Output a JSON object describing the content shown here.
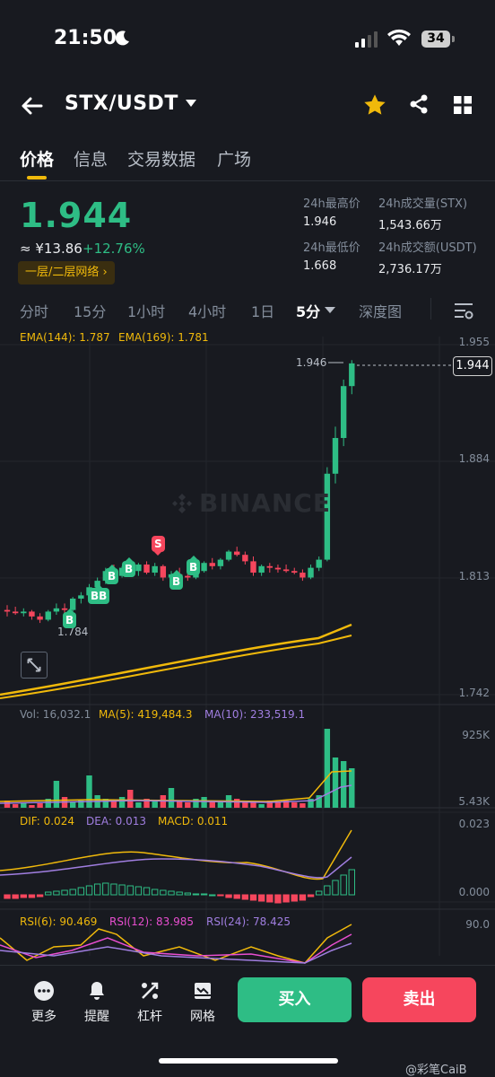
{
  "status": {
    "time": "21:50",
    "battery": "34"
  },
  "header": {
    "pair": "STX/USDT"
  },
  "tabs": [
    "价格",
    "信息",
    "交易数据",
    "广场"
  ],
  "ticker": {
    "price": "1.944",
    "cny": "≈ ¥13.86",
    "change": "+12.76%",
    "badge": "一层/二层网络 ›",
    "high_label": "24h最高价",
    "high": "1.946",
    "low_label": "24h最低价",
    "low": "1.668",
    "vol_label": "24h成交量(STX)",
    "vol": "1,543.66万",
    "amt_label": "24h成交额(USDT)",
    "amt": "2,736.17万"
  },
  "intervals": [
    "分时",
    "15分",
    "1小时",
    "4小时",
    "1日",
    "5分",
    "深度图"
  ],
  "main_chart": {
    "ema144": "EMA(144): 1.787",
    "ema169": "EMA(169): 1.781",
    "axis": [
      "1.955",
      "1.884",
      "1.813",
      "1.742"
    ],
    "high_marker": "1.946",
    "low_marker": "1.784",
    "last_price_tag": "1.944",
    "watermark": "BINANCE"
  },
  "volume_panel": {
    "vol": "Vol: 16,032.1",
    "ma5": "MA(5): 419,484.3",
    "ma10": "MA(10): 233,519.1",
    "axis_top": "925K",
    "axis_bottom": "5.43K"
  },
  "macd_panel": {
    "dif": "DIF: 0.024",
    "dea": "DEA: 0.013",
    "macd": "MACD: 0.011",
    "axis_top": "0.023",
    "axis_bottom": "0.000"
  },
  "rsi_panel": {
    "rsi6": "RSI(6): 90.469",
    "rsi12": "RSI(12): 83.985",
    "rsi24": "RSI(24): 78.425",
    "axis_top": "90.0"
  },
  "trade_marks": [
    "B",
    "BB",
    "B",
    "B",
    "S",
    "B",
    "B"
  ],
  "bottom_bar": {
    "more": "更多",
    "alert": "提醒",
    "leverage": "杠杆",
    "grid": "网格",
    "buy": "买入",
    "sell": "卖出"
  },
  "watermark_user": "@彩笔CaiB",
  "colors": {
    "up": "#2ebd85",
    "down": "#f6465d",
    "accent": "#f0b90b",
    "bg": "#181a20"
  }
}
